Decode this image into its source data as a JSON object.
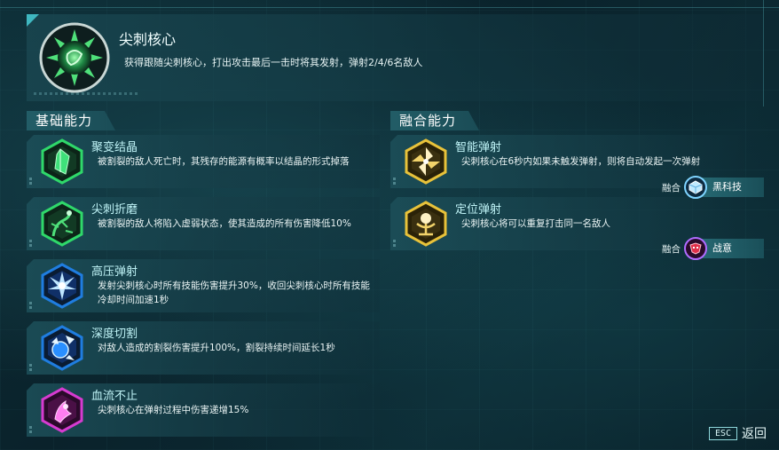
{
  "core": {
    "title": "尖刺核心",
    "description": "获得跟随尖刺核心，打出攻击最后一击时将其发射，弹射2/4/6名敌人",
    "icon": "spiked-core-icon"
  },
  "basic_section": {
    "title": "基础能力",
    "abilities": [
      {
        "name": "聚变结晶",
        "description": "被割裂的敌人死亡时，其残存的能源有概率以结晶的形式掉落",
        "icon": "crystal-icon",
        "color": "#2fd86a"
      },
      {
        "name": "尖刺折磨",
        "description": "被割裂的敌人将陷入虚弱状态，使其造成的所有伤害降低10%",
        "icon": "thorn-vine-icon",
        "color": "#2fd86a"
      },
      {
        "name": "高压弹射",
        "description": "发射尖刺核心时所有技能伤害提升30%，收回尖刺核心时所有技能冷却时间加速1秒",
        "icon": "burst-star-icon",
        "color": "#1f7de0"
      },
      {
        "name": "深度切割",
        "description": "对敌人造成的割裂伤害提升100%，割裂持续时间延长1秒",
        "icon": "blade-cut-icon",
        "color": "#1f7de0"
      },
      {
        "name": "血流不止",
        "description": "尖刺核心在弹射过程中伤害递增15%",
        "icon": "bleeding-icon",
        "color": "#d63bd0"
      }
    ]
  },
  "fusion_section": {
    "title": "融合能力",
    "abilities": [
      {
        "name": "智能弹射",
        "description": "尖刺核心在6秒内如果未触发弹射，则将自动发起一次弹射",
        "icon": "pinwheel-icon",
        "color": "#e8c23a",
        "fusion": {
          "label": "融合",
          "name": "黑科技",
          "icon": "tech-cube-icon"
        }
      },
      {
        "name": "定位弹射",
        "description": "尖刺核心将可以重复打击同一名敌人",
        "icon": "target-beacon-icon",
        "color": "#e8c23a",
        "fusion": {
          "label": "融合",
          "name": "战意",
          "icon": "battle-mask-icon"
        }
      }
    ]
  },
  "footer": {
    "esc_key": "ESC",
    "back_label": "返回"
  }
}
